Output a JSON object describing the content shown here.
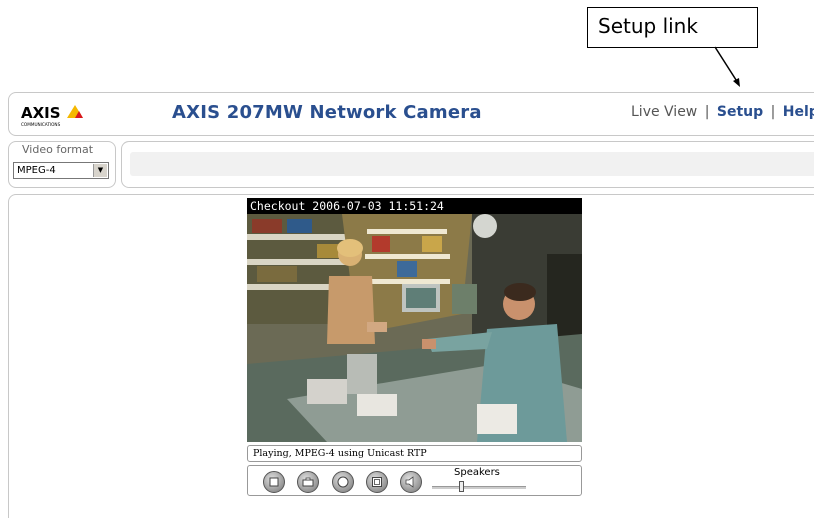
{
  "annotation": {
    "label": "Setup link"
  },
  "header": {
    "logo_text": "AXIS",
    "logo_subtext": "COMMUNICATIONS",
    "title": "AXIS 207MW Network Camera",
    "nav": [
      {
        "label": "Live View",
        "active": false
      },
      {
        "label": "Setup",
        "active": true
      },
      {
        "label": "Help",
        "active": false
      }
    ],
    "separator": "|"
  },
  "video_format": {
    "label": "Video format",
    "selected": "MPEG-4"
  },
  "video": {
    "caption": "Checkout 2006-07-03 11:51:24",
    "status": "Playing, MPEG-4 using Unicast RTP"
  },
  "controls": {
    "buttons": [
      "stop-icon",
      "snapshot-icon",
      "record-icon",
      "fullscreen-icon",
      "speaker-icon"
    ],
    "speakers_label": "Speakers",
    "volume": 0.3
  },
  "colors": {
    "title_blue": "#2a4f8f",
    "axis_yellow": "#f5b800",
    "axis_red": "#d8171e"
  }
}
